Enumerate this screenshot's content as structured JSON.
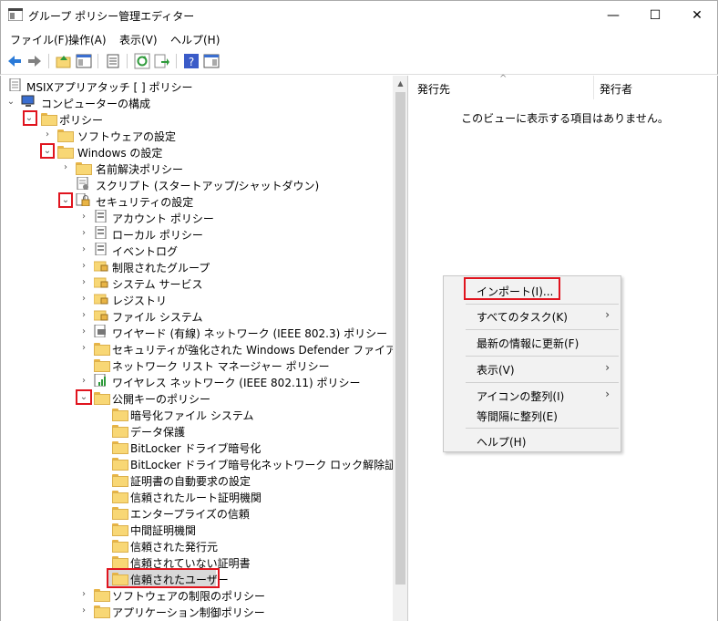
{
  "window": {
    "title": "グループ ポリシー管理エディター",
    "min": "—",
    "max": "☐",
    "close": "✕"
  },
  "menu": [
    "ファイル(F)",
    "操作(A)",
    "表示(V)",
    "ヘルプ(H)"
  ],
  "tree": {
    "root": "MSIXアプリアタッチ [                                                        ] ポリシー",
    "items": [
      {
        "label": "コンピューターの構成"
      },
      {
        "label": "ポリシー"
      },
      {
        "label": "ソフトウェアの設定"
      },
      {
        "label": "Windows の設定"
      },
      {
        "label": "名前解決ポリシー"
      },
      {
        "label": "スクリプト (スタートアップ/シャットダウン)"
      },
      {
        "label": "セキュリティの設定"
      },
      {
        "label": "アカウント ポリシー"
      },
      {
        "label": "ローカル ポリシー"
      },
      {
        "label": "イベントログ"
      },
      {
        "label": "制限されたグループ"
      },
      {
        "label": "システム サービス"
      },
      {
        "label": "レジストリ"
      },
      {
        "label": "ファイル システム"
      },
      {
        "label": "ワイヤード (有線) ネットワーク (IEEE 802.3) ポリシー"
      },
      {
        "label": "セキュリティが強化された Windows Defender ファイアウォール"
      },
      {
        "label": "ネットワーク リスト マネージャー ポリシー"
      },
      {
        "label": "ワイヤレス ネットワーク (IEEE 802.11) ポリシー"
      },
      {
        "label": "公開キーのポリシー"
      },
      {
        "label": "暗号化ファイル システム"
      },
      {
        "label": "データ保護"
      },
      {
        "label": "BitLocker ドライブ暗号化"
      },
      {
        "label": "BitLocker ドライブ暗号化ネットワーク ロック解除証明書"
      },
      {
        "label": "証明書の自動要求の設定"
      },
      {
        "label": "信頼されたルート証明機関"
      },
      {
        "label": "エンタープライズの信頼"
      },
      {
        "label": "中間証明機関"
      },
      {
        "label": "信頼された発行元"
      },
      {
        "label": "信頼されていない証明書"
      },
      {
        "label": "信頼されたユーザー"
      },
      {
        "label": "ソフトウェアの制限のポリシー"
      },
      {
        "label": "アプリケーション制御ポリシー"
      }
    ]
  },
  "list": {
    "columns": [
      "発行先",
      "発行者"
    ],
    "empty_message": "このビューに表示する項目はありません。"
  },
  "context_menu": {
    "items": [
      "インポート(I)...",
      "すべてのタスク(K)",
      "最新の情報に更新(F)",
      "表示(V)",
      "アイコンの整列(I)",
      "等間隔に整列(E)",
      "ヘルプ(H)"
    ],
    "submenu_arrow": "›"
  },
  "colors": {
    "highlight": "#e0141e",
    "folder": "#f8d775",
    "selection": "#d9d9d9"
  }
}
